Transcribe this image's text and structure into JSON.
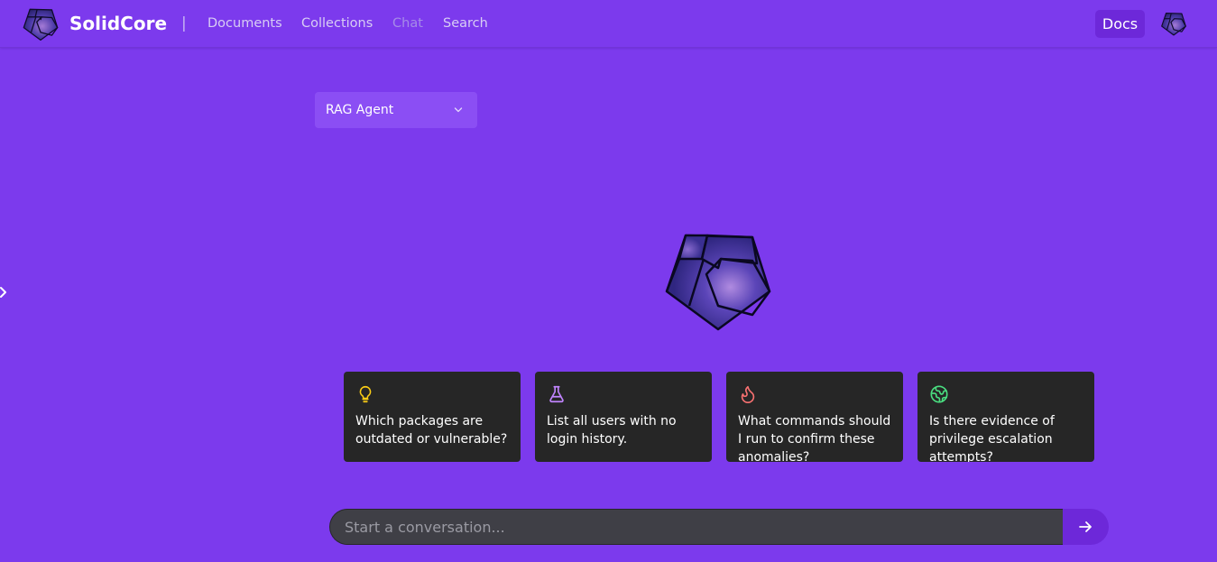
{
  "header": {
    "brand": "SolidCore",
    "divider": "|",
    "nav": [
      {
        "label": "Documents",
        "active": true
      },
      {
        "label": "Collections",
        "active": true
      },
      {
        "label": "Chat",
        "active": false
      },
      {
        "label": "Search",
        "active": true
      }
    ],
    "docs_label": "Docs"
  },
  "agent_select": {
    "value": "RAG Agent"
  },
  "suggestions": [
    {
      "icon": "lightbulb-icon",
      "color": "#facc15",
      "text": "Which packages are outdated or vulnerable?"
    },
    {
      "icon": "flask-icon",
      "color": "#c084fc",
      "text": "List all users with no login history."
    },
    {
      "icon": "flame-icon",
      "color": "#f87171",
      "text": "What commands should I run to confirm these anomalies?"
    },
    {
      "icon": "globe-icon",
      "color": "#4ade80",
      "text": "Is there evidence of privilege escalation attempts?"
    }
  ],
  "chat": {
    "placeholder": "Start a conversation..."
  },
  "colors": {
    "background": "#7c3aed",
    "accent": "#6d28d9",
    "card": "#262626",
    "input": "#3f3f46"
  }
}
